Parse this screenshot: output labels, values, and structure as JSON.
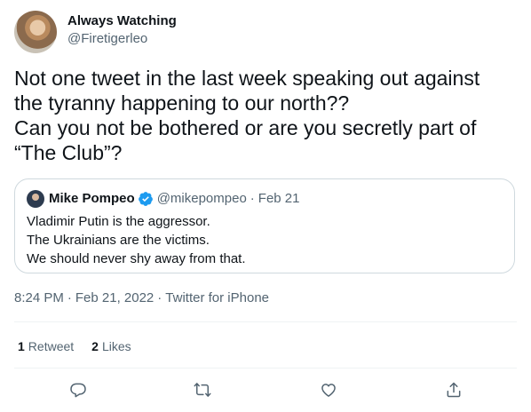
{
  "author": {
    "display_name": "Always Watching",
    "handle": "@Firetigerleo"
  },
  "tweet": {
    "text": "Not one tweet in the last week speaking out against\nthe tyranny happening to our north??\nCan you not be bothered or are you secretly part of\n“The Club”?"
  },
  "quoted_tweet": {
    "display_name": "Mike Pompeo",
    "handle": "@mikepompeo",
    "separator": "·",
    "date": "Feb 21",
    "text": "Vladimir Putin is the aggressor.\nThe Ukrainians are the victims.\nWe should never shy away from that."
  },
  "meta": {
    "time": "8:24 PM",
    "date": "Feb 21, 2022",
    "source": "Twitter for iPhone",
    "separator": "·"
  },
  "stats": {
    "retweets_count": "1",
    "retweets_label": "Retweet",
    "likes_count": "2",
    "likes_label": "Likes"
  },
  "actions": [
    "reply-icon",
    "retweet-icon",
    "like-icon",
    "share-icon"
  ],
  "colors": {
    "text": "#0f1419",
    "secondary": "#536471",
    "verified": "#1d9bf0",
    "border": "#cfd9de"
  }
}
